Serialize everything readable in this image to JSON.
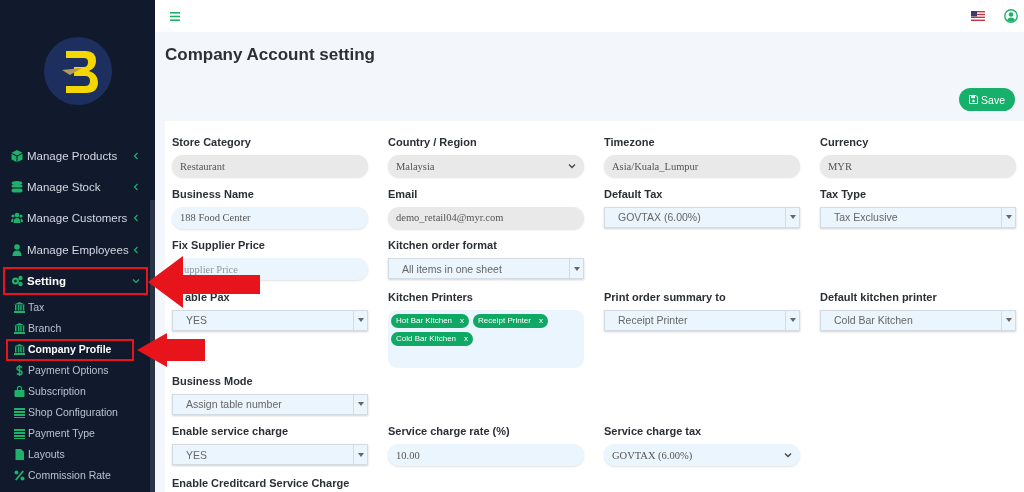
{
  "sidebar": {
    "items": [
      {
        "label": "Manage Products",
        "expanded": false,
        "highlighted": false
      },
      {
        "label": "Manage Stock",
        "expanded": false,
        "highlighted": false
      },
      {
        "label": "Manage Customers",
        "expanded": false,
        "highlighted": false
      },
      {
        "label": "Manage Employees",
        "expanded": false,
        "highlighted": false
      },
      {
        "label": "Setting",
        "expanded": true,
        "highlighted": true,
        "children": [
          {
            "label": "Tax",
            "selected": false,
            "highlighted": false
          },
          {
            "label": "Branch",
            "selected": false,
            "highlighted": false
          },
          {
            "label": "Company Profile",
            "selected": true,
            "highlighted": true
          },
          {
            "label": "Payment Options",
            "selected": false,
            "highlighted": false
          },
          {
            "label": "Subscription",
            "selected": false,
            "highlighted": false
          },
          {
            "label": "Shop Configuration",
            "selected": false,
            "highlighted": false
          },
          {
            "label": "Payment Type",
            "selected": false,
            "highlighted": false
          },
          {
            "label": "Layouts",
            "selected": false,
            "highlighted": false
          },
          {
            "label": "Commission Rate",
            "selected": false,
            "highlighted": false
          }
        ]
      }
    ]
  },
  "page": {
    "title": "Company Account setting",
    "save_button": "Save"
  },
  "form": {
    "rows": [
      {
        "fields": [
          {
            "label": "Store Category",
            "kind": "input",
            "value": "Restaurant",
            "disabled": true
          },
          {
            "label": "Country / Region",
            "kind": "native-select",
            "value": "Malaysia",
            "disabled": true
          },
          {
            "label": "Timezone",
            "kind": "input",
            "value": "Asia/Kuala_Lumpur",
            "disabled": true
          },
          {
            "label": "Currency",
            "kind": "input",
            "value": "MYR",
            "disabled": true
          }
        ]
      },
      {
        "fields": [
          {
            "label": "Business Name",
            "kind": "input",
            "value": "188 Food Center",
            "disabled": false
          },
          {
            "label": "Email",
            "kind": "input",
            "value": "demo_retail04@myr.com",
            "disabled": true
          },
          {
            "label": "Default Tax",
            "kind": "select",
            "value": "GOVTAX (6.00%)"
          },
          {
            "label": "Tax Type",
            "kind": "select",
            "value": "Tax Exclusive"
          }
        ]
      },
      {
        "fields": [
          {
            "label": "Fix Supplier Price",
            "kind": "input",
            "placeholder": "upplier Price",
            "disabled": false
          },
          {
            "label": "Kitchen order format",
            "kind": "select",
            "value": "All items in one sheet"
          }
        ]
      },
      {
        "fields": [
          {
            "label": "able Pax",
            "kind": "select",
            "value": "YES"
          },
          {
            "label": "Kitchen Printers",
            "kind": "tags",
            "tags": [
              {
                "label": "Hot Bar Kitchen",
                "remove": "x"
              },
              {
                "label": "Receipt Printer",
                "remove": "x"
              },
              {
                "label": "Cold Bar Kitchen",
                "remove": "x"
              }
            ]
          },
          {
            "label": "Print order summary to",
            "kind": "select",
            "value": "Receipt Printer"
          },
          {
            "label": "Default kitchen printer",
            "kind": "select",
            "value": "Cold Bar Kitchen"
          }
        ]
      },
      {
        "fields": [
          {
            "label": "Business Mode",
            "kind": "select",
            "value": "Assign table number"
          }
        ]
      },
      {
        "fields": [
          {
            "label": "Enable service charge",
            "kind": "select",
            "value": "YES"
          },
          {
            "label": "Service charge rate (%)",
            "kind": "input",
            "value": "10.00",
            "disabled": false
          },
          {
            "label": "Service charge tax",
            "kind": "native-select",
            "value": "GOVTAX (6.00%)",
            "disabled": false
          }
        ]
      },
      {
        "fields": [
          {
            "label": "Enable Creditcard Service Charge",
            "kind": "label"
          }
        ]
      }
    ]
  }
}
